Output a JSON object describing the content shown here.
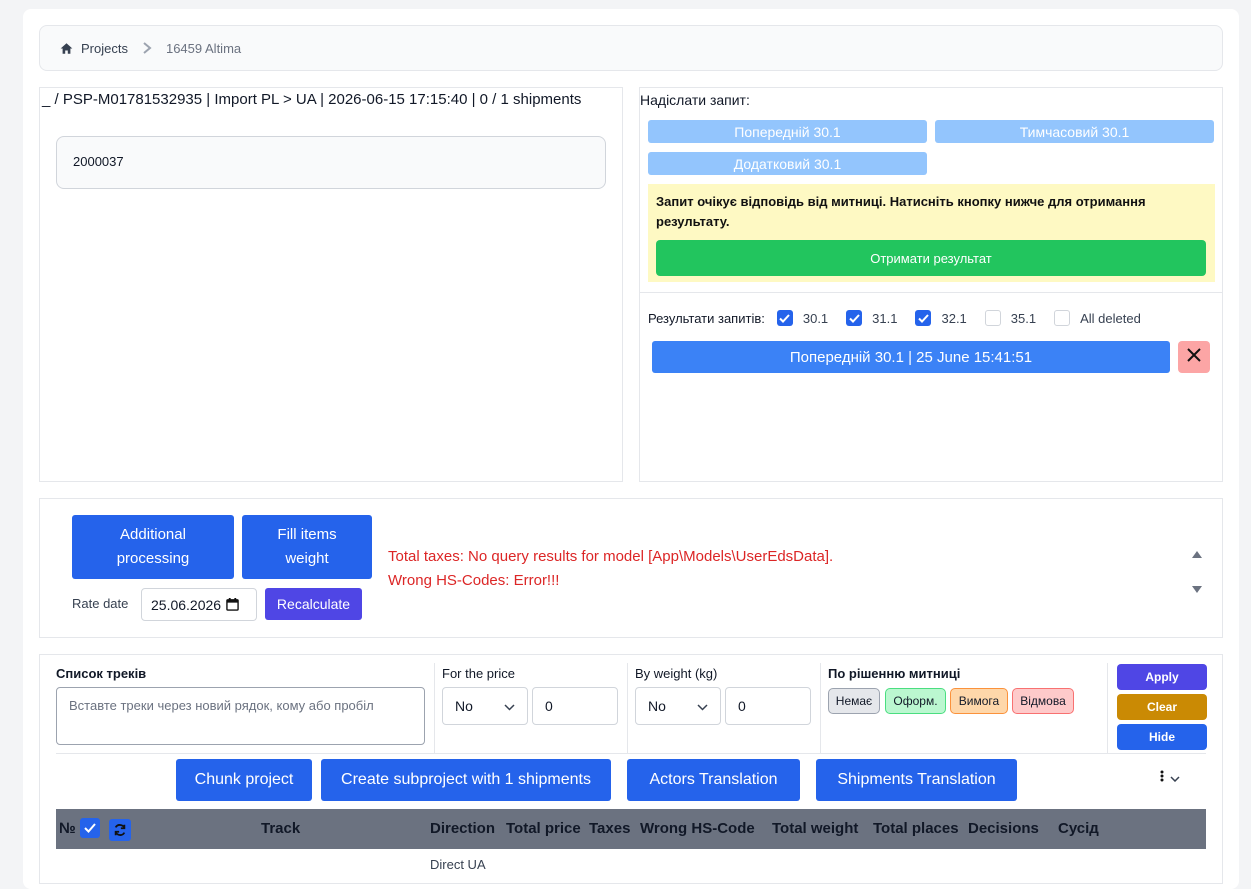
{
  "breadcrumb": {
    "home": "Projects",
    "current": "16459 Altima"
  },
  "project_header": "_ / PSP-M01781532935 | Import PL > UA | 2026-06-15 17:15:40 | 0 / 1 shipments",
  "code_value": "2000037",
  "send_request": {
    "title": "Надіслати запит:",
    "buttons": [
      "Попередній 30.1",
      "Тимчасовий 30.1",
      "Додатковий 30.1"
    ]
  },
  "notice": {
    "text": "Запит очікує відповідь від митниці. Натисніть кнопку нижче для отримання результату.",
    "button": "Отримати результат"
  },
  "results": {
    "label": "Результати запитів:",
    "checkboxes": [
      {
        "label": "30.1",
        "checked": true
      },
      {
        "label": "31.1",
        "checked": true
      },
      {
        "label": "32.1",
        "checked": true
      },
      {
        "label": "35.1",
        "checked": false
      },
      {
        "label": "All deleted",
        "checked": false
      }
    ],
    "entry": "Попередній 30.1 | 25 June 15:41:51"
  },
  "processing": {
    "additional_btn": "Additional processing",
    "fill_btn": "Fill items weight",
    "rate_label": "Rate date",
    "rate_value": "25.06.2026",
    "recalc_btn": "Recalculate",
    "errors": [
      "Total taxes: No query results for model [App\\Models\\UserEdsData].",
      "Wrong HS-Codes: Error!!!"
    ]
  },
  "filters": {
    "tracks_label": "Список треків",
    "tracks_placeholder": "Вставте треки через новий рядок, кому або пробіл",
    "price_label": "For the price",
    "price_select": "No",
    "price_value": "0",
    "weight_label": "By weight (kg)",
    "weight_select": "No",
    "weight_value": "0",
    "decision_label": "По рішенню митниці",
    "decisions": [
      "Немає",
      "Оформ.",
      "Вимога",
      "Відмова"
    ],
    "apply": "Apply",
    "clear": "Clear",
    "hide": "Hide"
  },
  "actions": [
    "Chunk project",
    "Create subproject with 1 shipments",
    "Actors Translation",
    "Shipments Translation"
  ],
  "table": {
    "headers": [
      "№",
      "Track",
      "Direction",
      "Total price",
      "Taxes",
      "Wrong HS-Code",
      "Total weight",
      "Total places",
      "Decisions",
      "Сусід"
    ],
    "partial_cell": "Direct UA"
  },
  "colors": {
    "primary": "#2563eb",
    "light_blue": "#93c5fd",
    "success": "#22c55e",
    "notice_bg": "#fef9c3",
    "error": "#dc2626",
    "indigo": "#4f46e5",
    "amber": "#ca8a04"
  }
}
